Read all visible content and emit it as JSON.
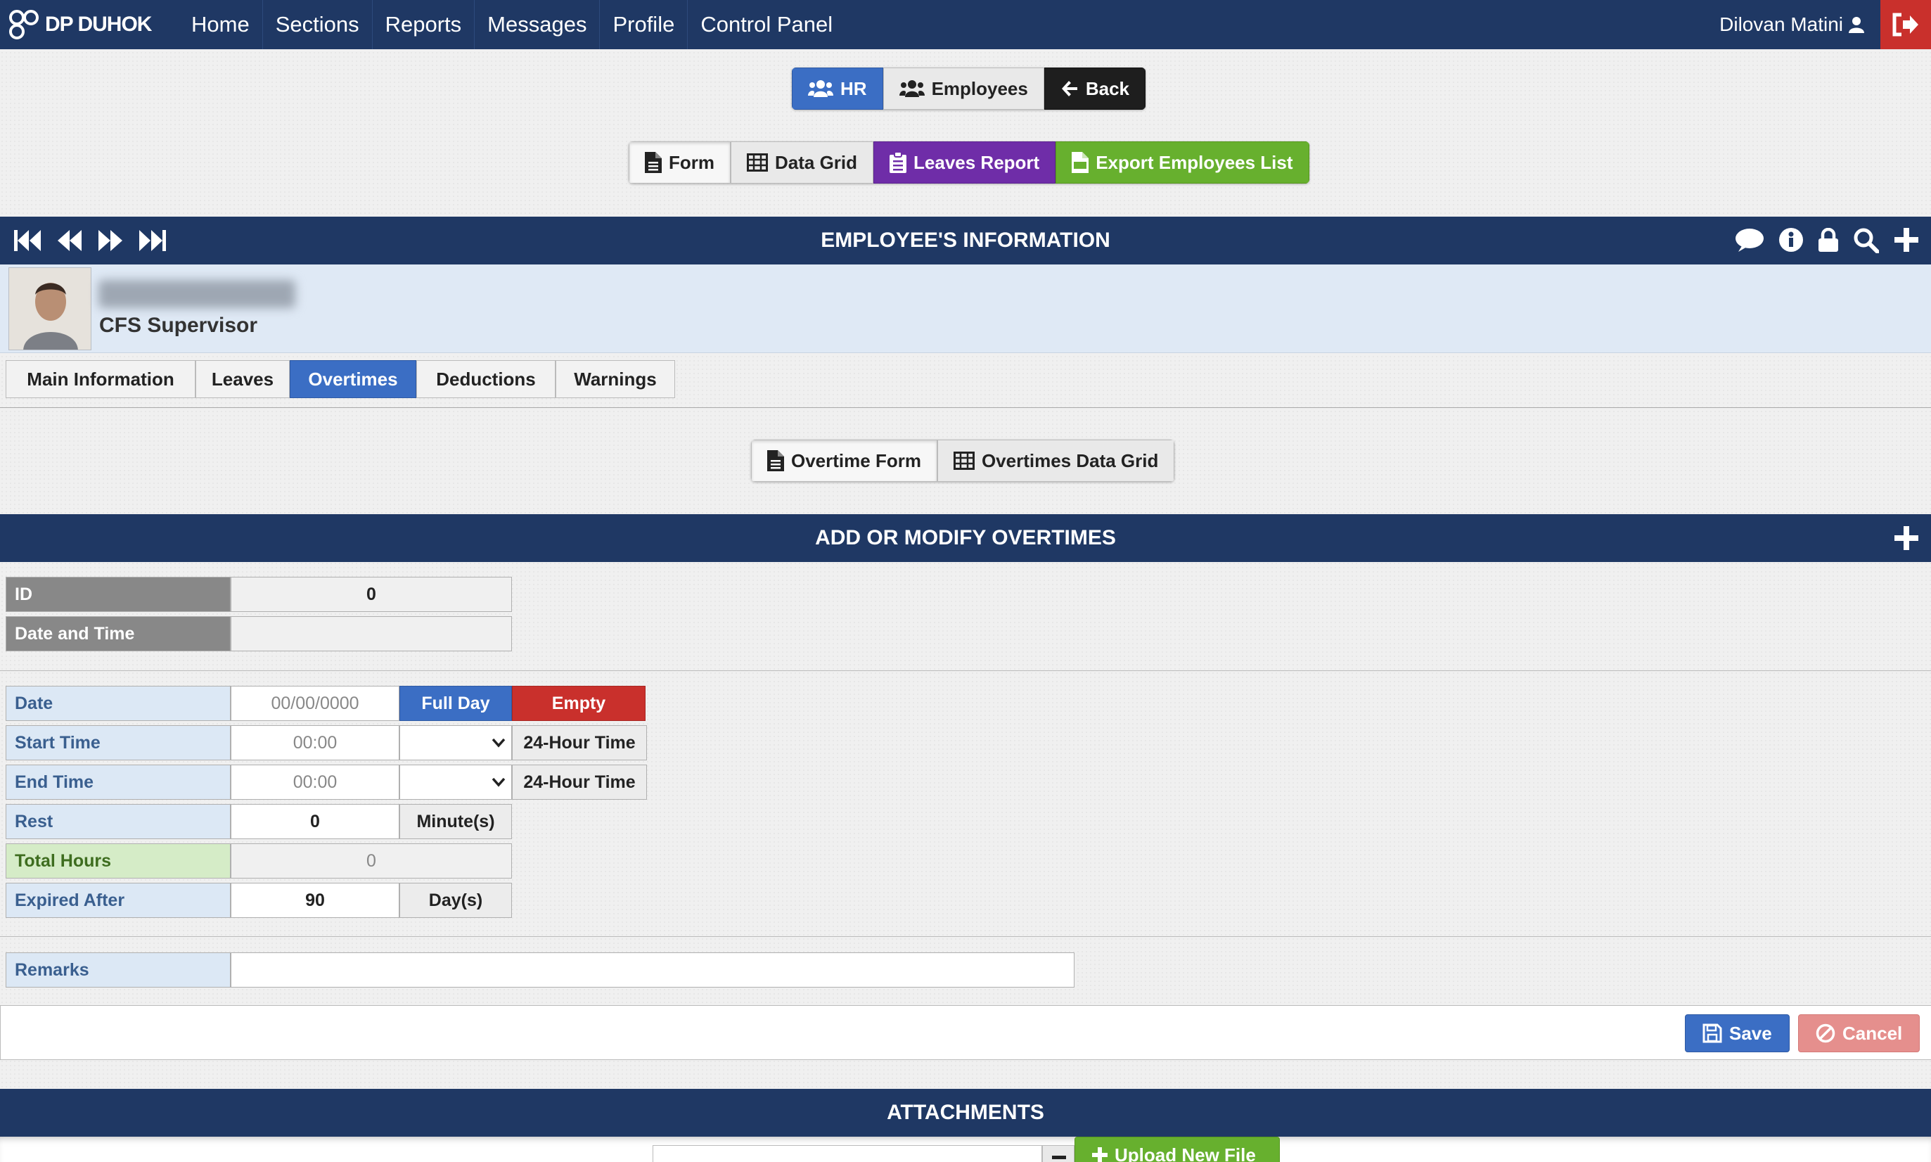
{
  "nav": {
    "brand": "DP DUHOK",
    "items": [
      "Home",
      "Sections",
      "Reports",
      "Messages",
      "Profile",
      "Control Panel"
    ],
    "user": "Dilovan Matini"
  },
  "module_buttons": {
    "hr": "HR",
    "employees": "Employees",
    "back": "Back"
  },
  "view_buttons": {
    "form": "Form",
    "data_grid": "Data Grid",
    "leaves_report": "Leaves Report",
    "export": "Export Employees List"
  },
  "employee_header": {
    "title": "EMPLOYEE'S INFORMATION"
  },
  "employee": {
    "job_title": "CFS Supervisor"
  },
  "tabs": [
    "Main Information",
    "Leaves",
    "Overtimes",
    "Deductions",
    "Warnings"
  ],
  "sub_buttons": {
    "overtime_form": "Overtime Form",
    "overtimes_grid": "Overtimes Data Grid"
  },
  "overtime_section": {
    "title": "ADD OR MODIFY OVERTIMES"
  },
  "meta": {
    "id_label": "ID",
    "id_value": "0",
    "datetime_label": "Date and Time",
    "datetime_value": ""
  },
  "form": {
    "date_label": "Date",
    "date_placeholder": "00/00/0000",
    "full_day": "Full Day",
    "empty": "Empty",
    "start_label": "Start Time",
    "start_placeholder": "00:00",
    "start_format": "24-Hour Time",
    "end_label": "End Time",
    "end_placeholder": "00:00",
    "end_format": "24-Hour Time",
    "rest_label": "Rest",
    "rest_value": "0",
    "rest_unit": "Minute(s)",
    "total_label": "Total Hours",
    "total_value": "0",
    "expired_label": "Expired After",
    "expired_value": "90",
    "expired_unit": "Day(s)",
    "remarks_label": "Remarks",
    "remarks_value": ""
  },
  "actions": {
    "save": "Save",
    "cancel": "Cancel"
  },
  "attachments": {
    "title": "ATTACHMENTS",
    "upload": "Upload New File"
  },
  "colors": {
    "navy": "#1f3864",
    "blue": "#3b6ec4",
    "red": "#c9302c",
    "purple": "#6f2da8",
    "green": "#67b02e"
  }
}
